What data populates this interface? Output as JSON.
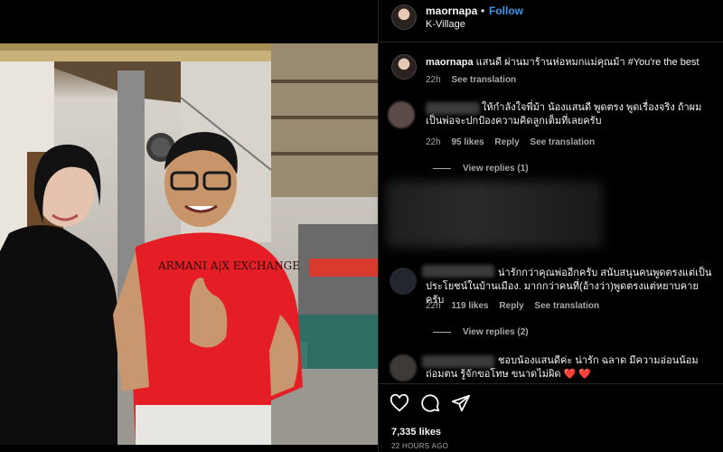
{
  "post": {
    "username": "maornapa",
    "follow_label": "Follow",
    "separator": "•",
    "location": "K-Village"
  },
  "caption": {
    "username": "maornapa",
    "text": " แสนดี ผ่านมาร้านห่อหมกแม่คุณม้า #You're the best",
    "time": "22h",
    "see_translation": "See translation"
  },
  "comments": [
    {
      "text": "ให้กำลังใจพี่ม้า น้องแสนดี พูดตรง พูดเรื่องจริง ถ้าผมเป็นพ่อจะปกป้องความคิดลูกเต็มที่เลยครับ",
      "time": "22h",
      "likes": "95 likes",
      "reply": "Reply",
      "see_translation": "See translation",
      "view_replies": "View replies (1)"
    },
    {
      "text": "น่ารักกว่าคุณพ่ออีกครับ สนับสนุนคนพูดตรงแต่เป็นประโยชน์ในบ้านเมือง. มากกว่าคนที่(อ้างว่า)พูดตรงแต่หยาบคาย ครับ",
      "time": "22h",
      "likes": "119 likes",
      "reply": "Reply",
      "see_translation": "See translation",
      "view_replies": "View replies (2)"
    },
    {
      "text": "ชอบน้องแสนดีค่ะ น่ารัก ฉลาด มีความอ่อนน้อมถ่อมตน รู้จักขอโทษ ขนาดไม่ผิด",
      "hearts": "❤️ ❤️"
    }
  ],
  "actions": {
    "likes": "7,335 likes",
    "time_ago": "22 HOURS AGO"
  },
  "icons": [
    "heart-outline-icon",
    "comment-icon",
    "share-icon"
  ]
}
